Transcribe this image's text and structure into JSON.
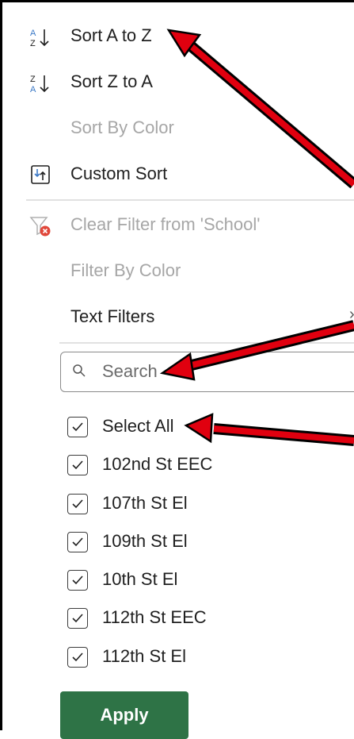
{
  "menu": {
    "sort_az": "Sort A to Z",
    "sort_za": "Sort Z to A",
    "sort_by_color": "Sort By Color",
    "custom_sort": "Custom Sort",
    "clear_filter": "Clear Filter from 'School'",
    "filter_by_color": "Filter By Color",
    "text_filters": "Text Filters",
    "icon_az_top": "A",
    "icon_az_bottom": "Z",
    "icon_za_top": "Z",
    "icon_za_bottom": "A"
  },
  "search": {
    "placeholder": "Search"
  },
  "list": {
    "items": [
      {
        "label": "Select All",
        "checked": true
      },
      {
        "label": "102nd St EEC",
        "checked": true
      },
      {
        "label": "107th St El",
        "checked": true
      },
      {
        "label": "109th St El",
        "checked": true
      },
      {
        "label": "10th St El",
        "checked": true
      },
      {
        "label": "112th St EEC",
        "checked": true
      },
      {
        "label": "112th St El",
        "checked": true
      }
    ]
  },
  "buttons": {
    "apply": "Apply"
  },
  "colors": {
    "apply_bg": "#2e7346",
    "annotation_arrow": "#e0000f",
    "disabled_text": "#a6a6a6",
    "sort_icon_blue": "#3b78c6",
    "clear_filter_red": "#e0473a"
  },
  "icons": [
    "sort-az-icon",
    "sort-za-icon",
    "custom-sort-icon",
    "clear-filter-icon",
    "search-icon",
    "checkmark-icon"
  ]
}
